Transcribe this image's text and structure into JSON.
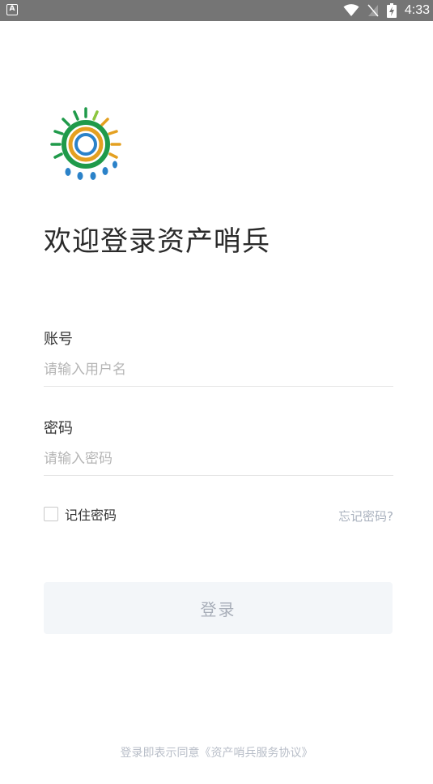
{
  "status_bar": {
    "left_icon_letter": "A",
    "time": "4:33"
  },
  "login": {
    "title": "欢迎登录资产哨兵",
    "account_label": "账号",
    "account_placeholder": "请输入用户名",
    "password_label": "密码",
    "password_placeholder": "请输入密码",
    "remember_label": "记住密码",
    "forgot_label": "忘记密码?",
    "login_button": "登录",
    "agreement": "登录即表示同意《资产哨兵服务协议》"
  },
  "colors": {
    "status_bar": "#757575",
    "login_button_bg": "#f3f6f9",
    "login_button_text": "#a8aeb9",
    "forgot_link": "#a8b0bd",
    "logo_green": "#1f9a4a",
    "logo_blue": "#2b82c9",
    "logo_orange": "#e4a020"
  }
}
